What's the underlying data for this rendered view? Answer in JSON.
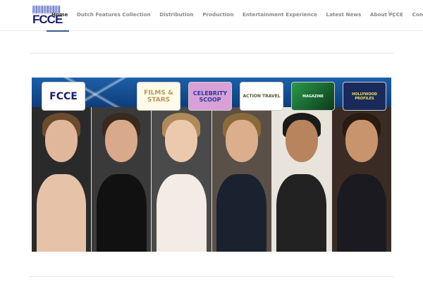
{
  "header": {
    "logo_text": "FCCE",
    "nav": [
      "Home",
      "Dutch Features Collection",
      "Distribution",
      "Production",
      "Entertainment Experience",
      "Latest News",
      "About FCCE",
      "Contact"
    ],
    "search_icon": "search-icon"
  },
  "banner": {
    "badges": [
      "FCCE",
      "FILMS & STARS",
      "CELEBRITY SCOOP",
      "ACTION TRAVEL",
      "MAGAZINE",
      "HOLLYWOOD PROFILES"
    ]
  },
  "colors": {
    "accent": "#3a5d8f",
    "logo": "#1b1f6b",
    "banner_blue": "#1d5fa8"
  }
}
